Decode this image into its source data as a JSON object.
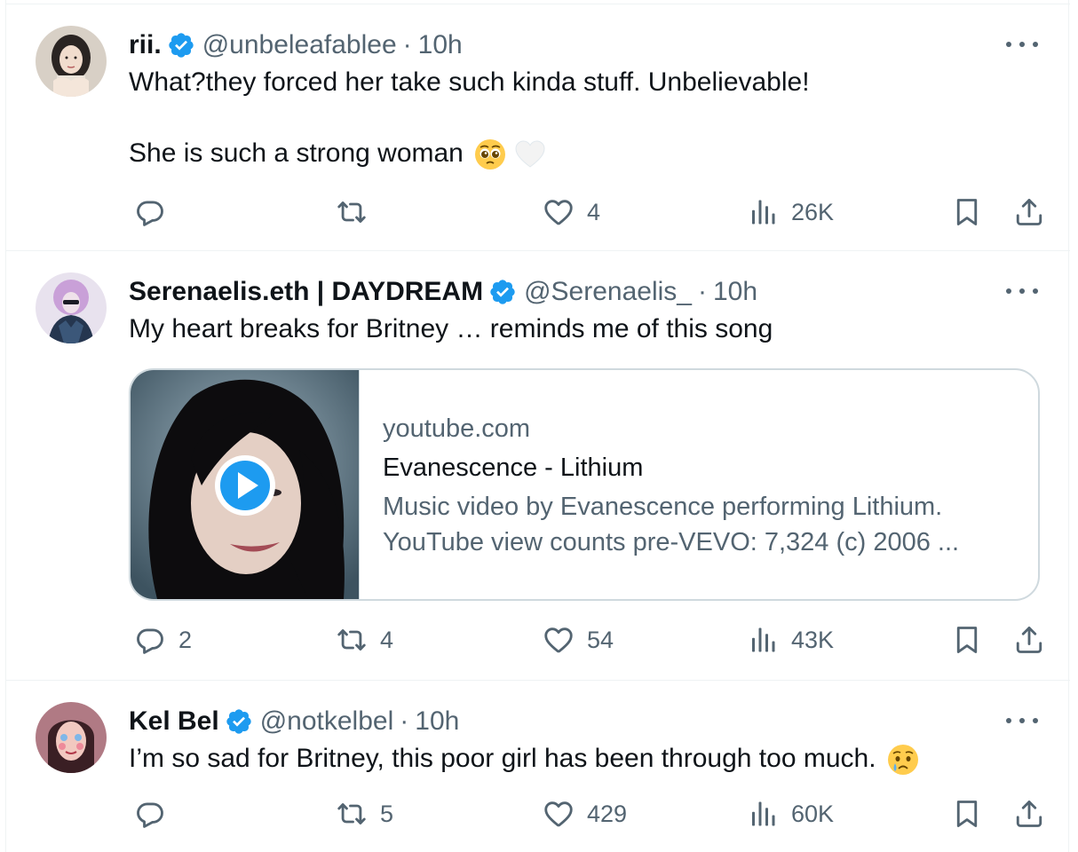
{
  "colors": {
    "verified_blue": "#1d9bf0",
    "secondary_text": "#536471",
    "primary_text": "#0f1419",
    "border": "#cfd9de",
    "divider": "#eff3f4"
  },
  "tweets": [
    {
      "name": "rii.",
      "handle": "@unbeleafablee",
      "separator": "·",
      "time": "10h",
      "lines": [
        "What?they forced her take such kinda stuff. Unbelievable!",
        "She is such a strong woman"
      ],
      "emojis": [
        "pleading-face",
        "white-heart"
      ],
      "actions": {
        "reply": "",
        "repost": "",
        "like": "4",
        "views": "26K"
      }
    },
    {
      "name": "Serenaelis.eth | DAYDREAM",
      "handle": "@Serenaelis_",
      "separator": "·",
      "time": "10h",
      "lines": [
        "My heart breaks for Britney … reminds me of this song"
      ],
      "card": {
        "domain": "youtube.com",
        "title": "Evanescence - Lithium",
        "description_line1": "Music video by Evanescence performing Lithium.",
        "description_line2": "YouTube view counts pre-VEVO: 7,324 (c) 2006 ..."
      },
      "actions": {
        "reply": "2",
        "repost": "4",
        "like": "54",
        "views": "43K"
      }
    },
    {
      "name": "Kel Bel",
      "handle": "@notkelbel",
      "separator": "·",
      "time": "10h",
      "lines": [
        "I’m so sad for Britney, this poor girl has been through too much."
      ],
      "emojis": [
        "crying-face"
      ],
      "actions": {
        "reply": "",
        "repost": "5",
        "like": "429",
        "views": "60K"
      }
    }
  ]
}
